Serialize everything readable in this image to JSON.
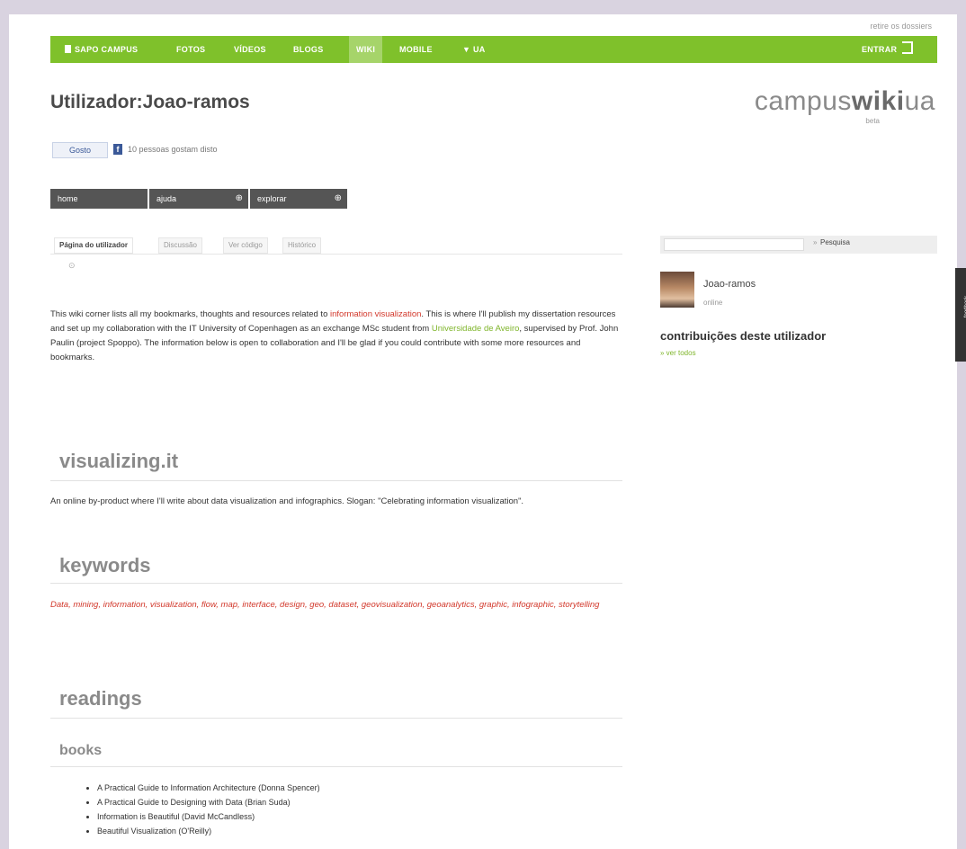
{
  "header": {
    "top_link": "retire os dossiers"
  },
  "navbar": {
    "items": [
      "SAPO CAMPUS",
      "FOTOS",
      "VÍDEOS",
      "BLOGS",
      "WIKI",
      "MOBILE",
      "▼ UA"
    ],
    "active": "WIKI",
    "login": "ENTRAR"
  },
  "page": {
    "title": "Utilizador:Joao-ramos"
  },
  "logo": {
    "part1": "campus",
    "part2": "wiki",
    "part3": "ua",
    "sub": "beta"
  },
  "social": {
    "like_label": "Gosto",
    "like_text": "10 pessoas gostam disto"
  },
  "menu": [
    "home",
    "ajuda",
    "explorar"
  ],
  "tabs": [
    "Página do utilizador",
    "Discussão",
    "Ver código",
    "Histórico"
  ],
  "search": {
    "placeholder": "",
    "separator": "»",
    "button": "Pesquisa"
  },
  "user": {
    "name": "Joao-ramos",
    "status": "online"
  },
  "sidebar": {
    "contrib_title": "contribuições deste utilizador",
    "see_all": "» ver todos"
  },
  "intro": {
    "t1": "This wiki corner lists all my bookmarks, thoughts and resources related to ",
    "link1": "information visualization",
    "t2": ". This is where I'll publish my dissertation resources and set up my collaboration with the IT University of Copenhagen as an exchange MSc student from ",
    "link2": "Universidade de Aveiro",
    "t3": ", supervised by Prof. John Paulin (project Spoppo). The information below is open to collaboration and I'll be glad if you could contribute with some more resources and bookmarks."
  },
  "sections": {
    "visualizing": "visualizing.it",
    "visualizing_text": "An online by-product where I'll write about data visualization and infographics. Slogan: \"Celebrating information visualization\".",
    "keywords": "keywords",
    "keywords_text": "Data, mining, information, visualization, flow, map, interface, design, geo, dataset, geovisualization, geoanalytics, graphic, infographic, storytelling",
    "readings": "readings",
    "books": "books"
  },
  "books": [
    "A Practical Guide to Information Architecture (Donna Spencer)",
    "A Practical Guide to Designing with Data (Brian Suda)",
    "Information is Beautiful (David McCandless)",
    "Beautiful Visualization (O'Reilly)"
  ],
  "feedback": {
    "label": "feedback"
  }
}
